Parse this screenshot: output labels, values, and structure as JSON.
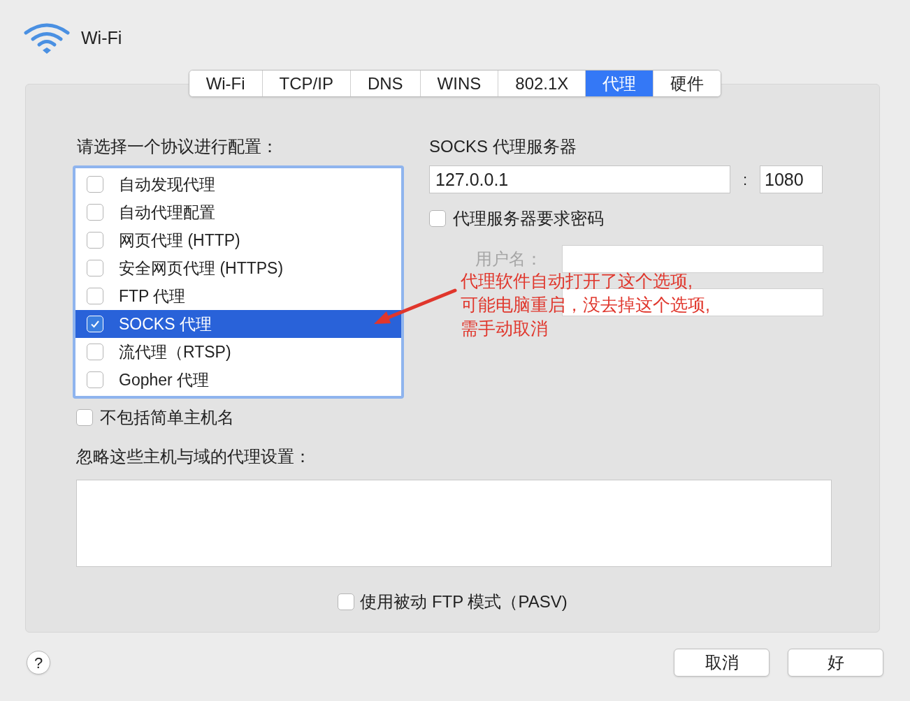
{
  "window": {
    "title": "Wi-Fi"
  },
  "tabs": [
    {
      "label": "Wi-Fi",
      "selected": false
    },
    {
      "label": "TCP/IP",
      "selected": false
    },
    {
      "label": "DNS",
      "selected": false
    },
    {
      "label": "WINS",
      "selected": false
    },
    {
      "label": "802.1X",
      "selected": false
    },
    {
      "label": "代理",
      "selected": true
    },
    {
      "label": "硬件",
      "selected": false
    }
  ],
  "protocol_list": {
    "label": "请选择一个协议进行配置：",
    "items": [
      {
        "label": "自动发现代理",
        "checked": false,
        "selected": false
      },
      {
        "label": "自动代理配置",
        "checked": false,
        "selected": false
      },
      {
        "label": "网页代理 (HTTP)",
        "checked": false,
        "selected": false
      },
      {
        "label": "安全网页代理 (HTTPS)",
        "checked": false,
        "selected": false
      },
      {
        "label": "FTP 代理",
        "checked": false,
        "selected": false
      },
      {
        "label": "SOCKS 代理",
        "checked": true,
        "selected": true
      },
      {
        "label": "流代理（RTSP)",
        "checked": false,
        "selected": false
      },
      {
        "label": "Gopher 代理",
        "checked": false,
        "selected": false
      }
    ]
  },
  "server": {
    "label": "SOCKS 代理服务器",
    "host": "127.0.0.1",
    "separator": ":",
    "port": "1080"
  },
  "requires_password": {
    "label": "代理服务器要求密码",
    "checked": false
  },
  "username": {
    "label": "用户名：",
    "disabled": true
  },
  "exclude_simple": {
    "label": "不包括简单主机名",
    "checked": false
  },
  "bypass": {
    "label": "忽略这些主机与域的代理设置："
  },
  "passive_ftp": {
    "label": "使用被动 FTP 模式（PASV)",
    "checked": false
  },
  "help_button": "?",
  "buttons": [
    "取消",
    "好"
  ],
  "annotation": {
    "lines": [
      "代理软件自动打开了这个选项,",
      "可能电脑重启，没去掉这个选项,",
      "需手动取消"
    ]
  }
}
